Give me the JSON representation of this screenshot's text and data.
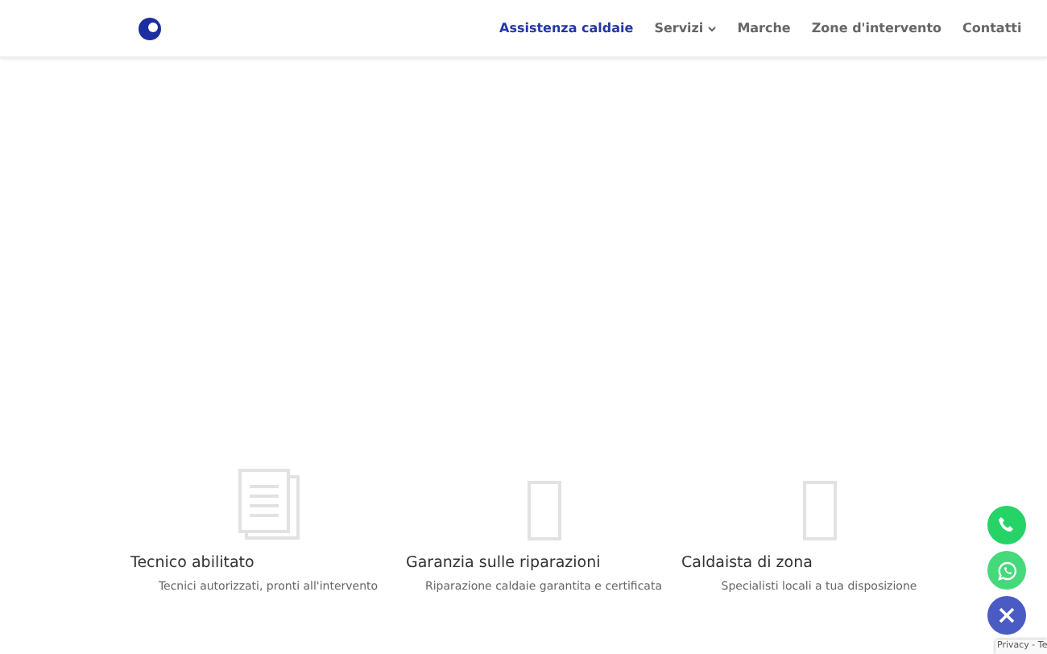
{
  "header": {
    "nav": [
      {
        "label": "Assistenza caldaie",
        "selected": true,
        "kind": "link"
      },
      {
        "label": "Servizi",
        "selected": false,
        "kind": "dropdown"
      },
      {
        "label": "Marche",
        "selected": false,
        "kind": "link"
      },
      {
        "label": "Zone d'intervento",
        "selected": false,
        "kind": "link"
      },
      {
        "label": "Contatti",
        "selected": false,
        "kind": "link"
      }
    ]
  },
  "features": [
    {
      "kind": "document",
      "title": "Tecnico abilitato",
      "text": "Tecnici autorizzati, pronti all'intervento"
    },
    {
      "kind": "missing-glyph",
      "title": "Garanzia sulle riparazioni",
      "text": "Riparazione caldaie garantita e certificata"
    },
    {
      "kind": "missing-glyph",
      "title": "Caldaista di zona",
      "text": "Specialisti locali a tua disposizione"
    }
  ],
  "floating_buttons": [
    {
      "kind": "phone"
    },
    {
      "kind": "whatsapp"
    },
    {
      "kind": "close"
    }
  ],
  "recaptcha_badge": {
    "text": "Privacy - Te"
  }
}
